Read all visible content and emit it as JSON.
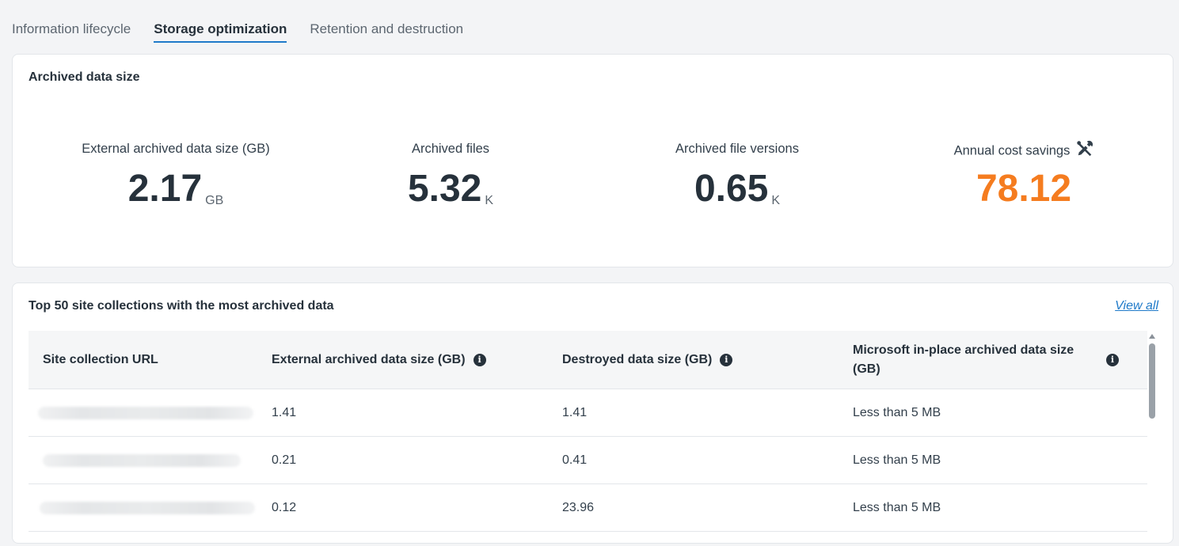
{
  "tabs": [
    {
      "label": "Information lifecycle",
      "active": false
    },
    {
      "label": "Storage optimization",
      "active": true
    },
    {
      "label": "Retention and destruction",
      "active": false
    }
  ],
  "archived": {
    "title": "Archived data size",
    "stats": [
      {
        "label": "External archived data size (GB)",
        "value": "2.17",
        "unit": "GB"
      },
      {
        "label": "Archived files",
        "value": "5.32",
        "unit": "K"
      },
      {
        "label": "Archived file versions",
        "value": "0.65",
        "unit": "K"
      },
      {
        "label": "Annual cost savings",
        "value": "78.12",
        "unit": "",
        "icon": "tools-icon",
        "color": "#f57c1f"
      }
    ]
  },
  "top": {
    "title": "Top 50 site collections with the most archived data",
    "view_all": "View all",
    "columns": [
      {
        "label": "Site collection URL",
        "info": false
      },
      {
        "label": "External archived data size (GB)",
        "info": true
      },
      {
        "label": "Destroyed data size (GB)",
        "info": true
      },
      {
        "label": "Microsoft in-place archived data size (GB)",
        "info": true
      }
    ],
    "rows": [
      {
        "external": "1.41",
        "destroyed": "1.41",
        "inplace": "Less than 5 MB"
      },
      {
        "external": "0.21",
        "destroyed": "0.41",
        "inplace": "Less than 5 MB"
      },
      {
        "external": "0.12",
        "destroyed": "23.96",
        "inplace": "Less than 5 MB"
      }
    ]
  },
  "colors": {
    "accent": "#1f7ac9",
    "orange": "#f57c1f"
  }
}
